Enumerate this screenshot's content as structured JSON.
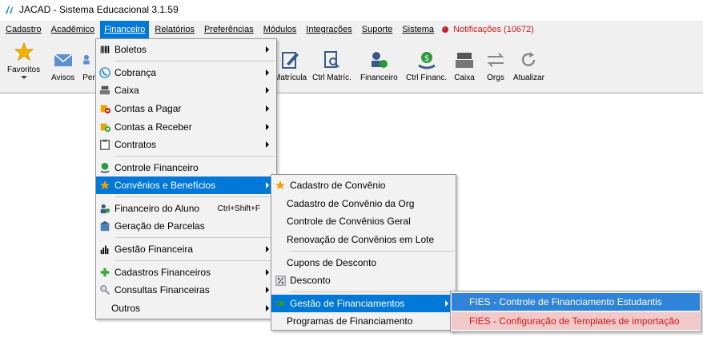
{
  "window": {
    "title": "JACAD - Sistema Educacional 3.1.59"
  },
  "menubar": {
    "items": [
      "Cadastro",
      "Acadêmico",
      "Financeiro",
      "Relatórios",
      "Preferências",
      "Módulos",
      "Integrações",
      "Suporte",
      "Sistema"
    ],
    "active": "Financeiro",
    "notifications": "Notificações (10672)"
  },
  "toolbar": {
    "items": [
      "Favoritos",
      "Avisos",
      "Per",
      "Matrícula",
      "Ctrl Matríc.",
      "Financeiro",
      "Ctrl Financ.",
      "Caixa",
      "Orgs",
      "Atualizar"
    ]
  },
  "financeiro_menu": {
    "items": [
      {
        "label": "Boletos",
        "icon": "barcode-icon",
        "submenu": true
      },
      {
        "label": "Cobrança",
        "icon": "phone-icon",
        "submenu": true
      },
      {
        "label": "Caixa",
        "icon": "cash-register-icon",
        "submenu": true
      },
      {
        "label": "Contas a Pagar",
        "icon": "coins-minus-icon",
        "submenu": true
      },
      {
        "label": "Contas a Receber",
        "icon": "coins-plus-icon",
        "submenu": true
      },
      {
        "label": "Contratos",
        "icon": "clipboard-icon",
        "submenu": true
      },
      {
        "label": "Controle Financeiro",
        "icon": "money-bag-icon",
        "submenu": false
      },
      {
        "label": "Convênios e Benefícios",
        "icon": "star-icon",
        "submenu": true
      },
      {
        "label": "Financeiro do Aluno",
        "icon": "student-money-icon",
        "submenu": false,
        "shortcut": "Ctrl+Shift+F"
      },
      {
        "label": "Geração de Parcelas",
        "icon": "building-icon",
        "submenu": false
      },
      {
        "label": "Gestão Financeira",
        "icon": "bar-chart-icon",
        "submenu": true
      },
      {
        "label": "Cadastros Financeiros",
        "icon": "green-plus-icon",
        "submenu": true
      },
      {
        "label": "Consultas Financeiras",
        "icon": "magnifier-icon",
        "submenu": true
      },
      {
        "label": "Outros",
        "icon": "",
        "submenu": true
      }
    ]
  },
  "convenios_menu": {
    "items": [
      {
        "label": "Cadastro de Convênio",
        "icon": "star-icon",
        "submenu": false
      },
      {
        "label": "Cadastro de Convênio da Org",
        "icon": "",
        "submenu": false
      },
      {
        "label": "Controle de Convênios Geral",
        "icon": "",
        "submenu": false
      },
      {
        "label": "Renovação de Convênios em Lote",
        "icon": "",
        "submenu": false
      },
      {
        "label": "Cupons de Desconto",
        "icon": "",
        "submenu": false
      },
      {
        "label": "Desconto",
        "icon": "percent-icon",
        "submenu": false
      },
      {
        "label": "Gestão de Financiamentos",
        "icon": "financing-icon",
        "submenu": true
      },
      {
        "label": "Programas de Financiamento",
        "icon": "",
        "submenu": false
      }
    ]
  },
  "financiamentos_menu": {
    "items": [
      {
        "label": "FIES - Controle de Financiamento Estudantis"
      },
      {
        "label": "FIES - Configuração de Templates de importação"
      }
    ]
  },
  "colors": {
    "highlight": "#0078d7",
    "notification": "#d11a1a",
    "danger_bg": "#f1c9c9"
  }
}
